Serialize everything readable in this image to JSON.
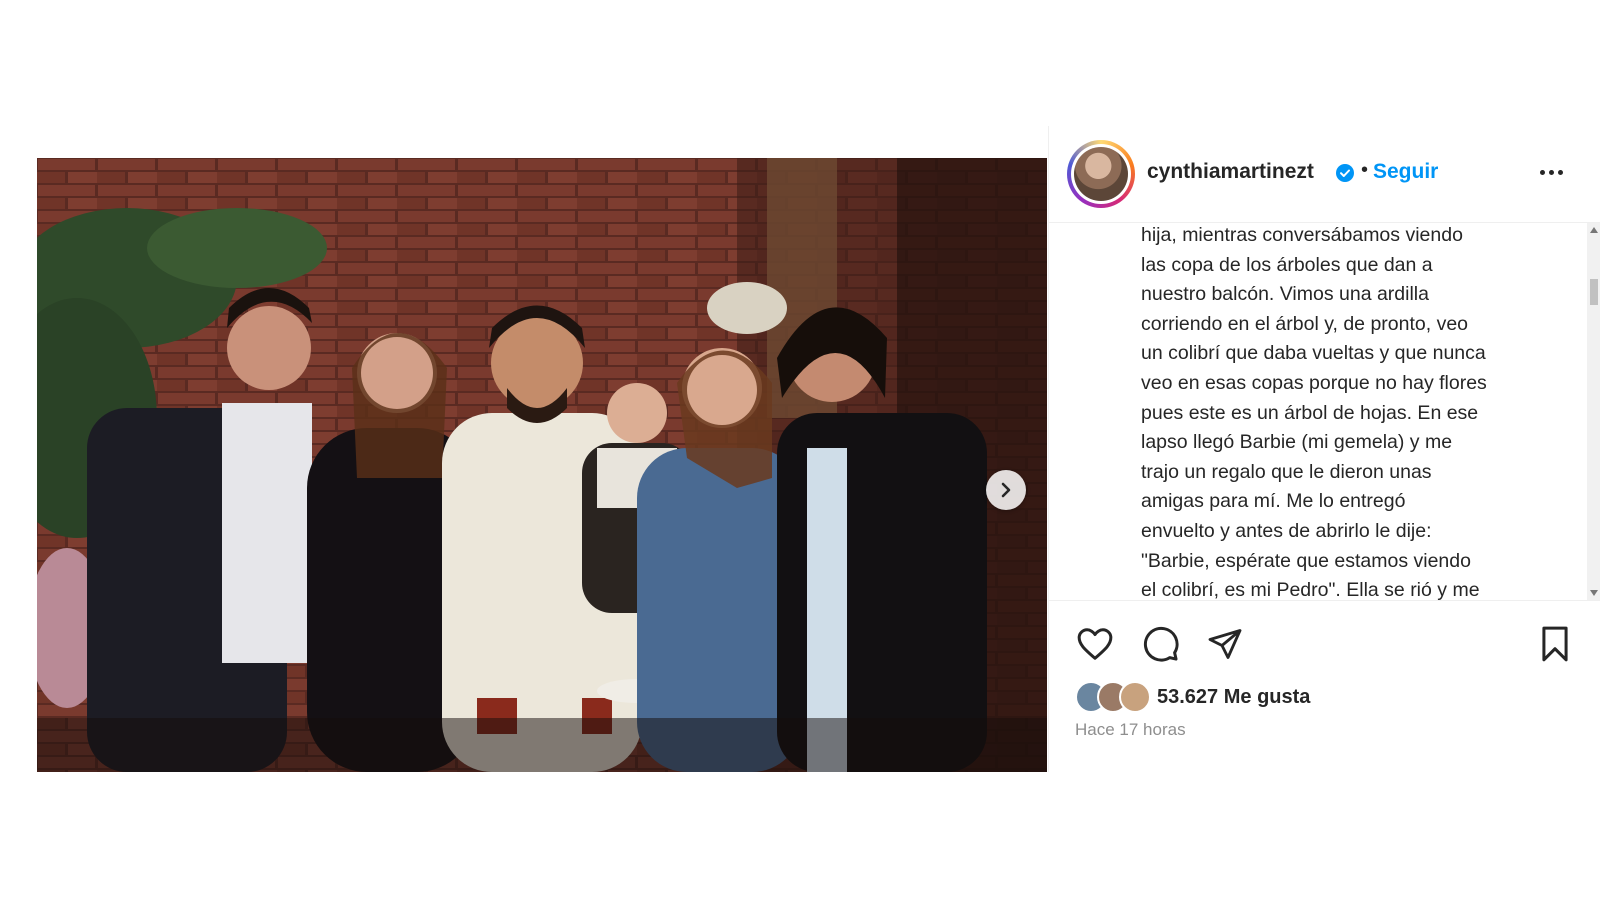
{
  "post": {
    "username": "cynthiamartinezt",
    "separator": "•",
    "follow_label": "Seguir",
    "caption_lines": [
      "hija, mientras conversábamos viendo",
      "las copa de los árboles que dan a",
      "nuestro balcón. Vimos una ardilla",
      "corriendo en el árbol y, de pronto, veo",
      "un colibrí que daba vueltas y que nunca",
      "veo en esas copas porque no hay flores",
      "pues este es un árbol de hojas. En ese",
      "lapso llegó Barbie (mi gemela) y me",
      "trajo un regalo que le dieron unas",
      "amigas para mí. Me lo entregó",
      "envuelto y antes de abrirlo le dije:",
      "\"Barbie, espérate que estamos viendo",
      "el colibrí, es mi Pedro\". Ella se rió y me"
    ],
    "likes_text": "53.627 Me gusta",
    "time_text": "Hace 17 horas"
  },
  "icons": {
    "verified": "verified-badge-icon",
    "more": "more-options-icon",
    "like": "heart-icon",
    "comment": "comment-icon",
    "share": "paper-plane-icon",
    "save": "bookmark-icon",
    "next": "chevron-right-icon"
  },
  "colors": {
    "accent": "#0095f6",
    "text": "#262626",
    "muted": "#8e8e8e"
  }
}
